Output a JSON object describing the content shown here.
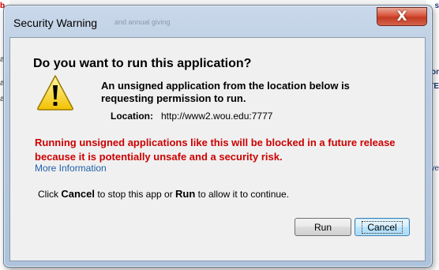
{
  "background": {
    "left_fragments": [
      "b",
      "ay",
      "ay",
      "ay"
    ],
    "right_fragments": [
      "s",
      "or",
      "TE",
      "ve"
    ]
  },
  "dialog": {
    "title": "Security Warning",
    "title_ghost": "and annual giving",
    "close_glyph": "X",
    "heading": "Do you want to run this application?",
    "message": "An unsigned application from the location below is requesting permission to run.",
    "location_label": "Location:",
    "location_value": "http://www2.wou.edu:7777",
    "warning": "Running unsigned applications like this will be blocked in a future release because it is potentially unsafe and a security risk.",
    "more_info": "More Information",
    "instruction": {
      "prefix": "Click ",
      "cancel_word": "Cancel",
      "middle": " to stop this app or ",
      "run_word": "Run",
      "suffix": " to allow it to continue."
    },
    "buttons": {
      "run": "Run",
      "cancel": "Cancel"
    }
  },
  "colors": {
    "warning_text": "#cc0000",
    "link": "#1f5fa8",
    "close_button": "#c43b22",
    "frame": "#b9cbe1"
  },
  "icons": {
    "warning": "warning-triangle-icon",
    "close": "close-icon"
  }
}
